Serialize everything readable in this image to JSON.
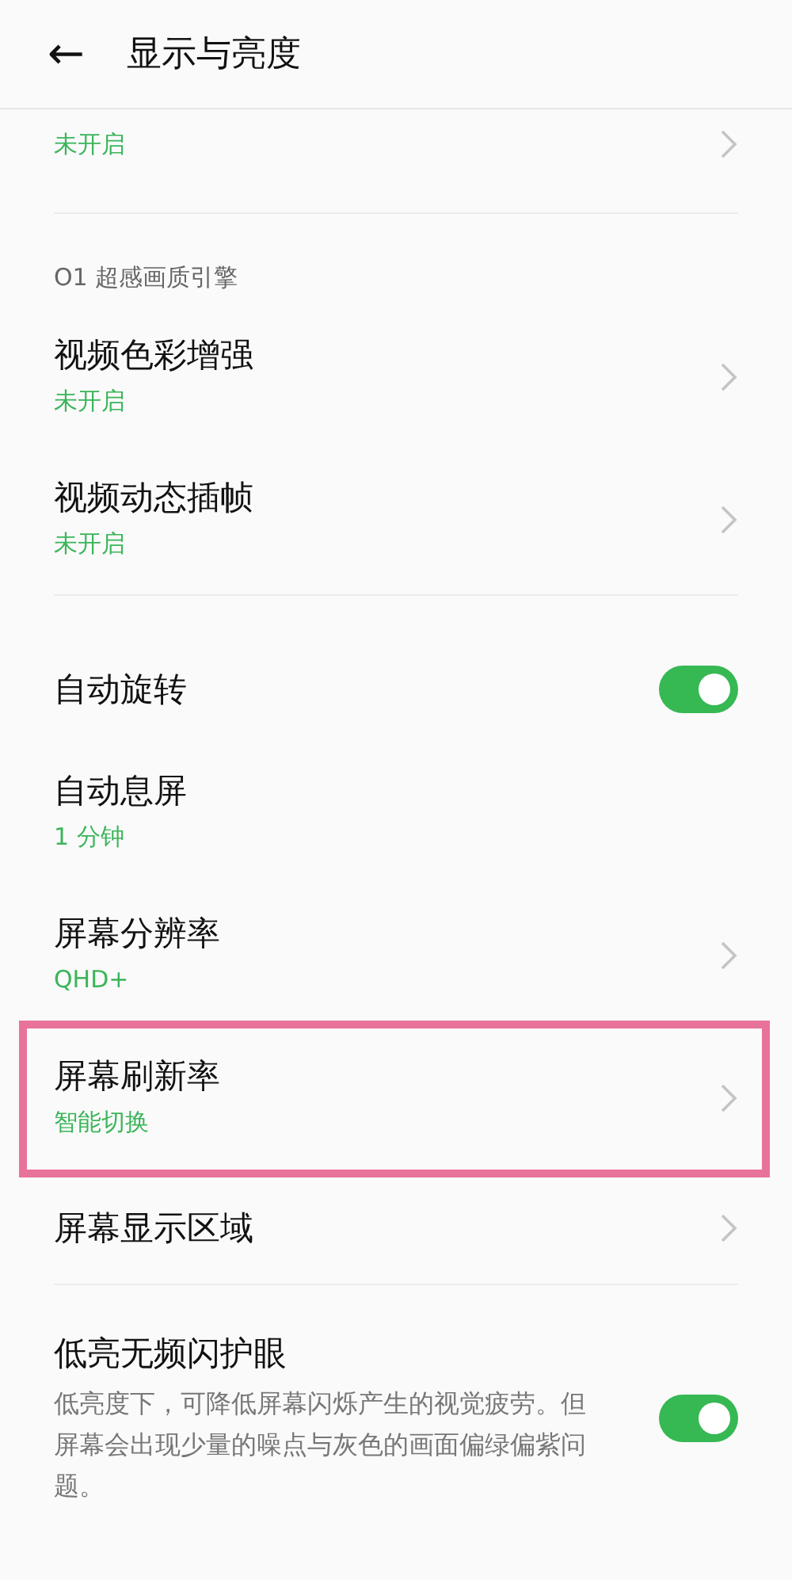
{
  "header": {
    "back": "←",
    "title": "显示与亮度"
  },
  "groups": [
    {
      "items": [
        {
          "kind": "partial",
          "subtitle": "未开启",
          "highlighted": false
        }
      ]
    },
    {
      "section": "O1 超感画质引擎",
      "items": [
        {
          "kind": "nav",
          "title": "视频色彩增强",
          "subtitle": "未开启",
          "highlighted": false
        },
        {
          "kind": "nav",
          "title": "视频动态插帧",
          "subtitle": "未开启",
          "highlighted": false
        }
      ]
    },
    {
      "items": [
        {
          "kind": "toggle",
          "title": "自动旋转",
          "on": true,
          "highlighted": false
        },
        {
          "kind": "plain",
          "title": "自动息屏",
          "subtitle": "1 分钟",
          "highlighted": false
        },
        {
          "kind": "nav",
          "title": "屏幕分辨率",
          "subtitle": "QHD+",
          "highlighted": false
        },
        {
          "kind": "nav",
          "title": "屏幕刷新率",
          "subtitle": "智能切换",
          "highlighted": true
        },
        {
          "kind": "nav",
          "title": "屏幕显示区域",
          "highlighted": false
        }
      ]
    },
    {
      "items": [
        {
          "kind": "toggle",
          "title": "低亮无频闪护眼",
          "description": "低亮度下，可降低屏幕闪烁产生的视觉疲劳。但屏幕会出现少量的噪点与灰色的画面偏绿偏紫问题。",
          "on": true,
          "highlighted": false
        }
      ]
    }
  ]
}
